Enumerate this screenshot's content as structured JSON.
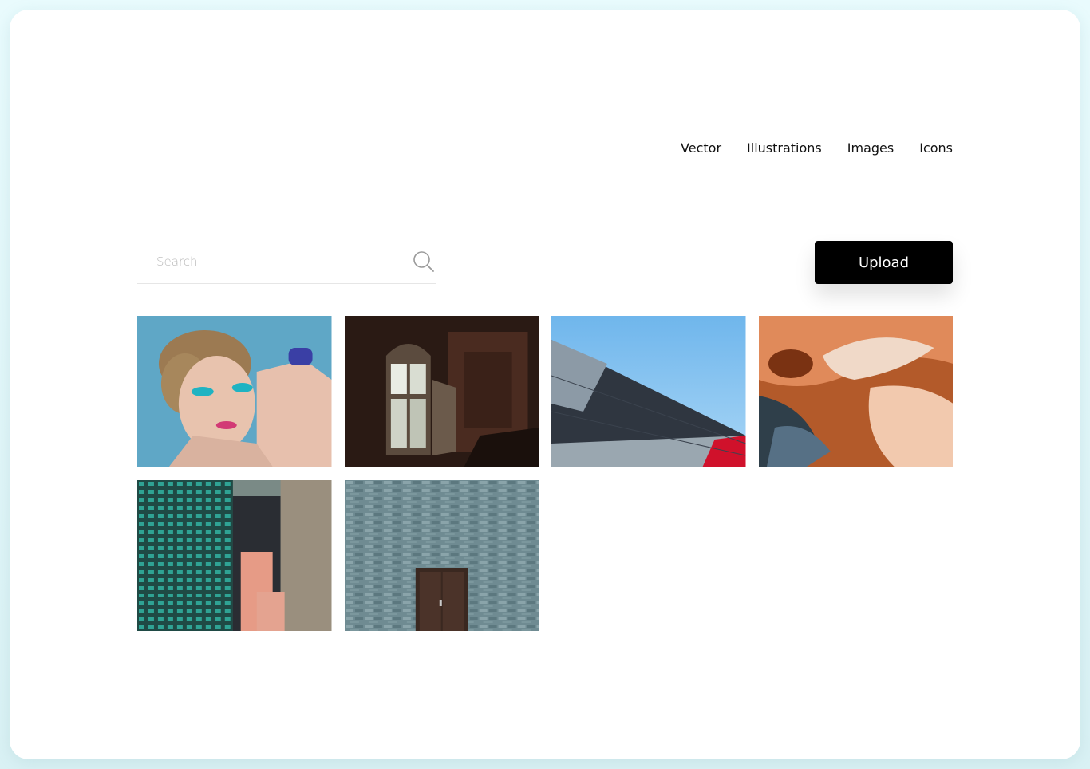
{
  "nav": {
    "items": [
      {
        "label": "Vector"
      },
      {
        "label": "Illustrations"
      },
      {
        "label": "Images"
      },
      {
        "label": "Icons"
      }
    ]
  },
  "search": {
    "placeholder": "Search",
    "value": ""
  },
  "upload": {
    "label": "Upload"
  },
  "gallery": {
    "images": [
      {
        "name": "makeup-portrait-image"
      },
      {
        "name": "dark-room-window-image"
      },
      {
        "name": "building-roof-sky-image"
      },
      {
        "name": "aerial-abstract-landscape-image"
      },
      {
        "name": "city-apartment-buildings-image"
      },
      {
        "name": "stone-wall-door-image"
      }
    ]
  },
  "colors": {
    "accent": "#000000",
    "background": "#e9fbfd",
    "card": "#ffffff"
  }
}
